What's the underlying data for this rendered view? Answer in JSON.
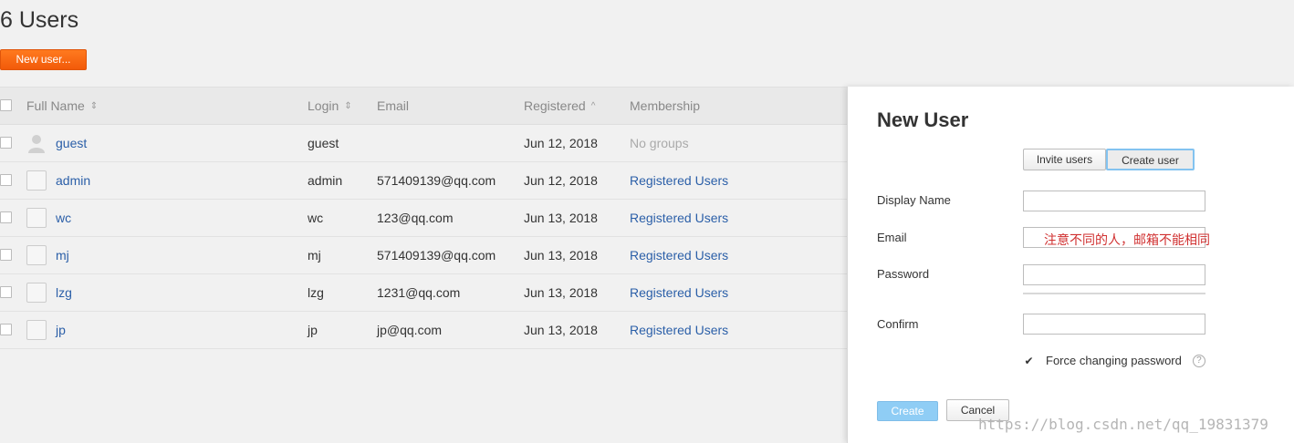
{
  "header": {
    "title": "6 Users",
    "new_user_label": "New user..."
  },
  "table": {
    "columns": {
      "full_name": "Full Name",
      "login": "Login",
      "email": "Email",
      "registered": "Registered",
      "membership": "Membership"
    },
    "rows": [
      {
        "name": "guest",
        "login": "guest",
        "email": "",
        "registered": "Jun 12, 2018",
        "membership": "No groups"
      },
      {
        "name": "admin",
        "login": "admin",
        "email": "571409139@qq.com",
        "registered": "Jun 12, 2018",
        "membership": "Registered Users"
      },
      {
        "name": "wc",
        "login": "wc",
        "email": "123@qq.com",
        "registered": "Jun 13, 2018",
        "membership": "Registered Users"
      },
      {
        "name": "mj",
        "login": "mj",
        "email": "571409139@qq.com",
        "registered": "Jun 13, 2018",
        "membership": "Registered Users"
      },
      {
        "name": "lzg",
        "login": "lzg",
        "email": "1231@qq.com",
        "registered": "Jun 13, 2018",
        "membership": "Registered Users"
      },
      {
        "name": "jp",
        "login": "jp",
        "email": "jp@qq.com",
        "registered": "Jun 13, 2018",
        "membership": "Registered Users"
      }
    ]
  },
  "panel": {
    "title": "New User",
    "invite_label": "Invite users",
    "create_user_label": "Create user",
    "display_name_label": "Display Name",
    "email_label": "Email",
    "email_annotation": "注意不同的人，邮箱不能相同",
    "password_label": "Password",
    "confirm_label": "Confirm",
    "force_label": "Force changing password",
    "create_label": "Create",
    "cancel_label": "Cancel"
  },
  "watermark": "https://blog.csdn.net/qq_19831379",
  "colors": {
    "accent": "#f25a0a",
    "link": "#2b5fa8",
    "annotation": "#d03030"
  }
}
